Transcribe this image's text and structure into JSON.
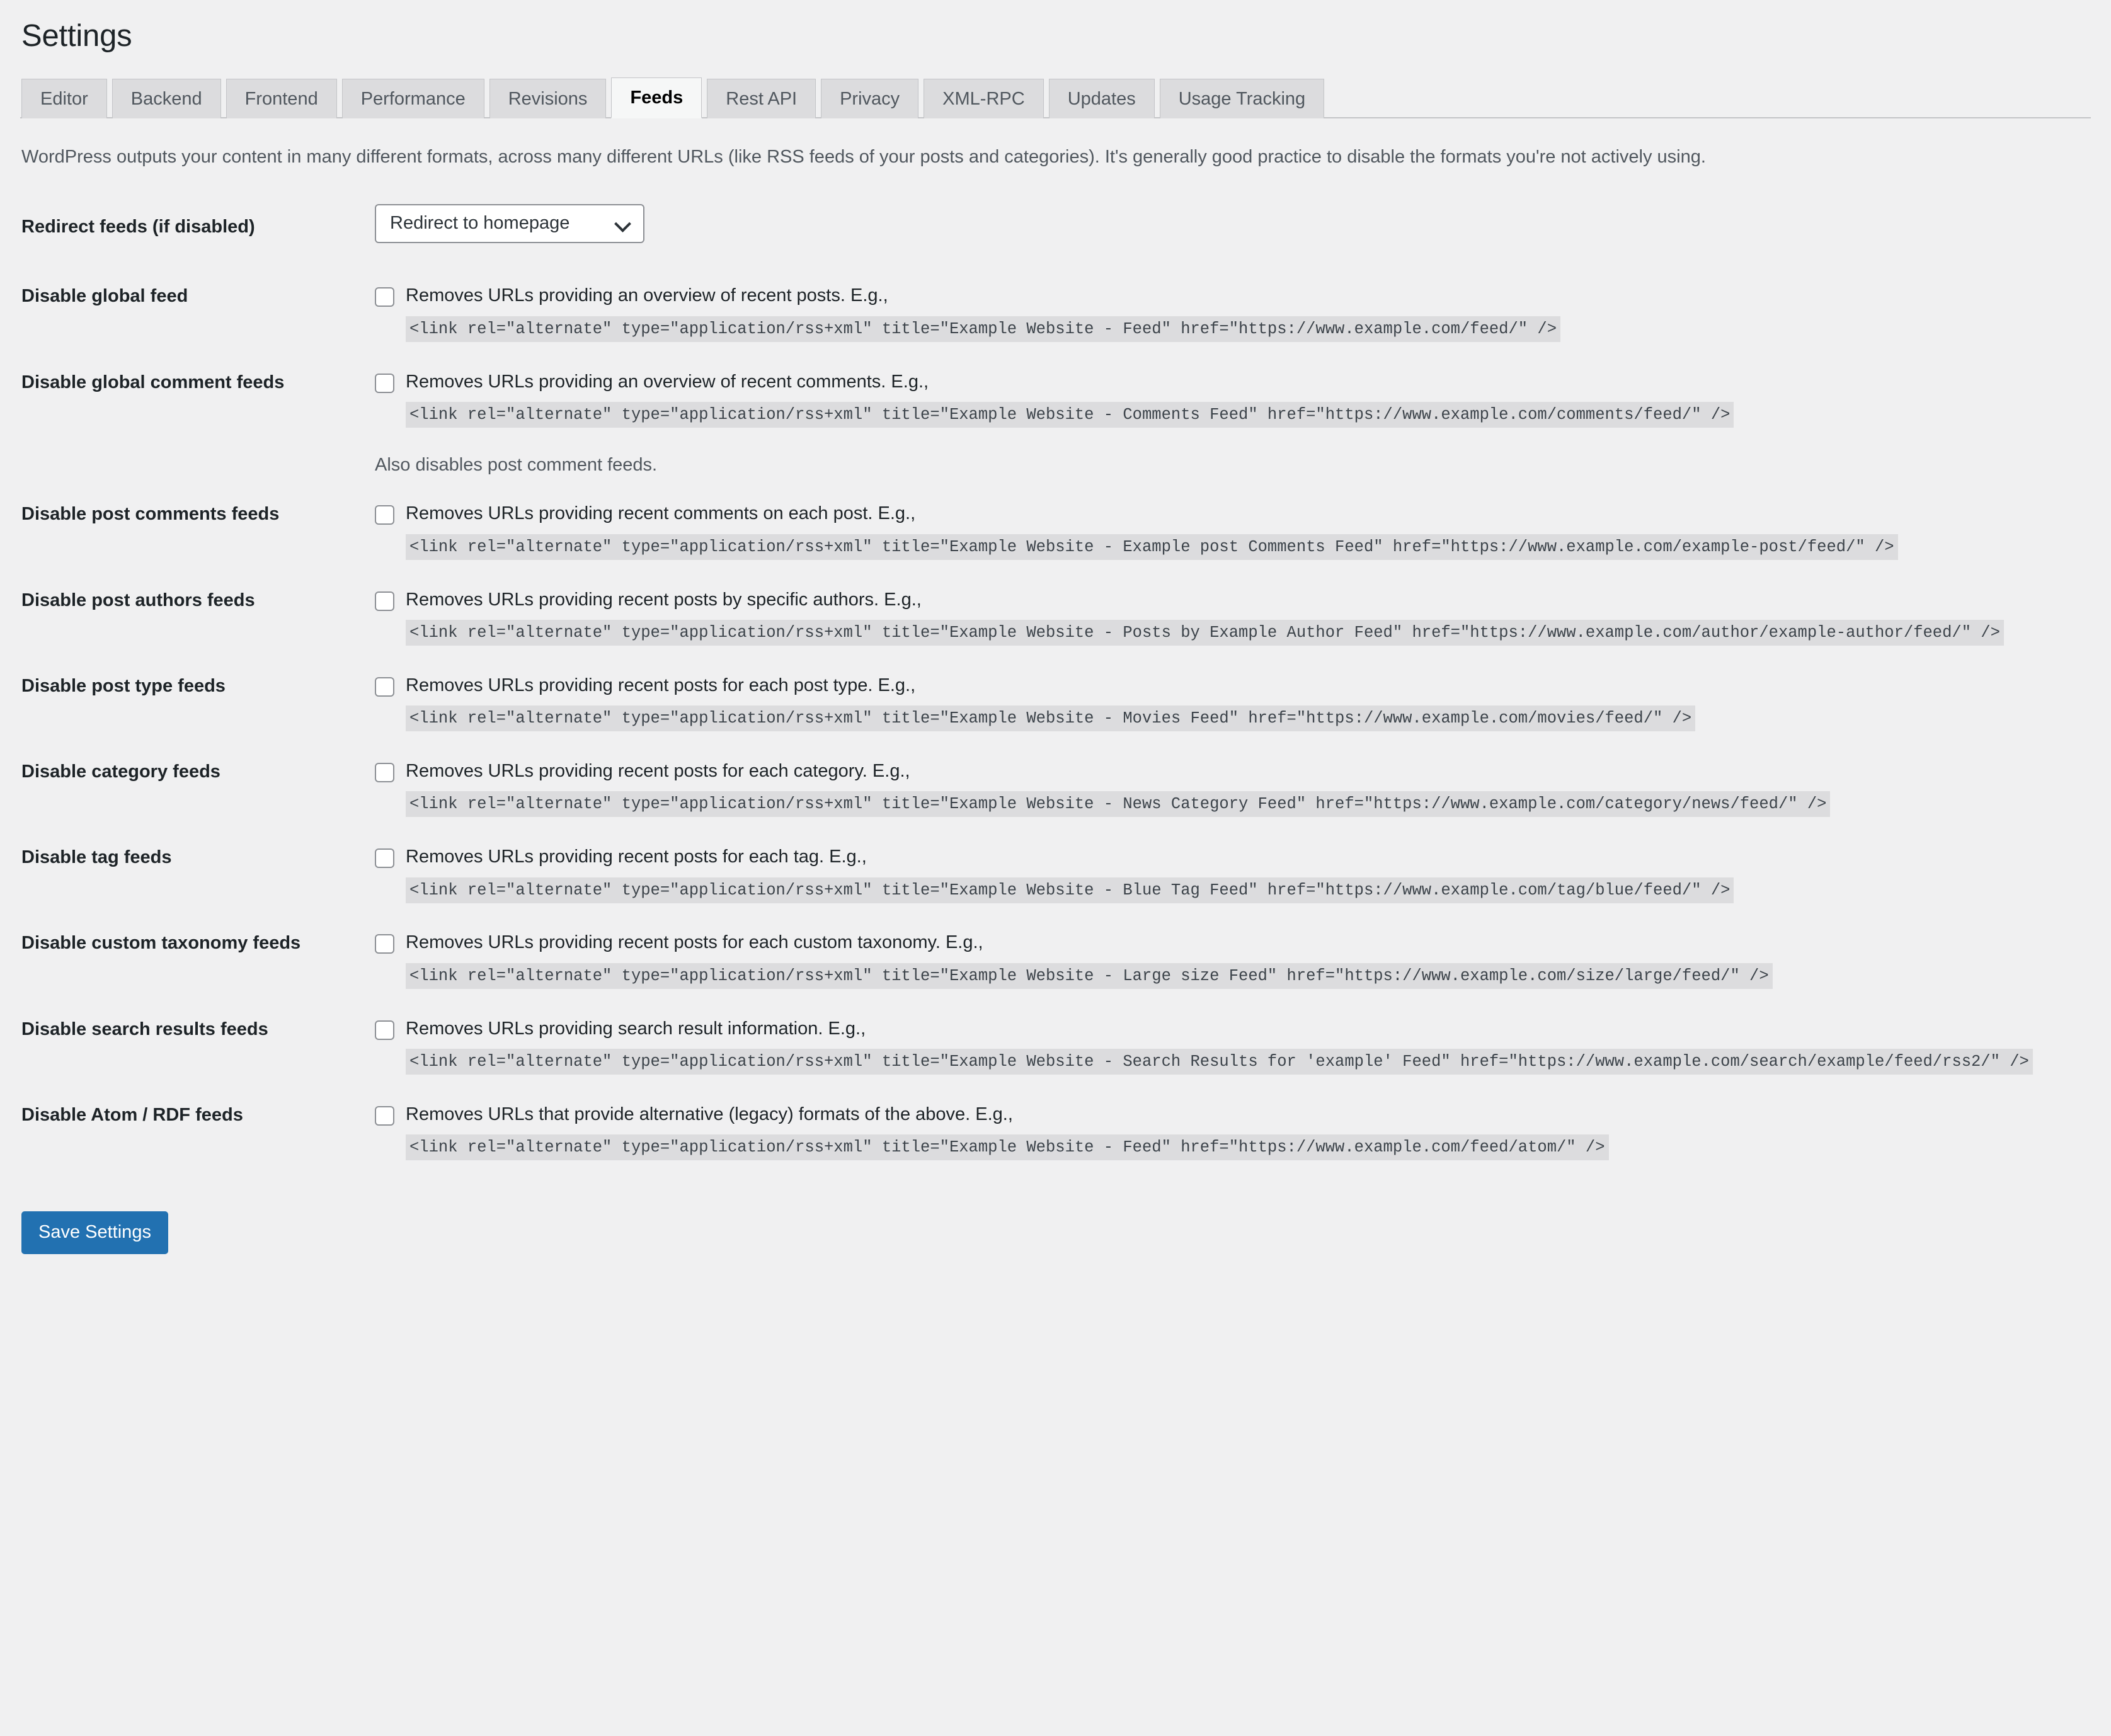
{
  "header": {
    "title": "Settings"
  },
  "tabs": [
    {
      "label": "Editor",
      "active": false
    },
    {
      "label": "Backend",
      "active": false
    },
    {
      "label": "Frontend",
      "active": false
    },
    {
      "label": "Performance",
      "active": false
    },
    {
      "label": "Revisions",
      "active": false
    },
    {
      "label": "Feeds",
      "active": true
    },
    {
      "label": "Rest API",
      "active": false
    },
    {
      "label": "Privacy",
      "active": false
    },
    {
      "label": "XML-RPC",
      "active": false
    },
    {
      "label": "Updates",
      "active": false
    },
    {
      "label": "Usage Tracking",
      "active": false
    }
  ],
  "intro": "WordPress outputs your content in many different formats, across many different URLs (like RSS feeds of your posts and categories). It's generally good practice to disable the formats you're not actively using.",
  "redirect": {
    "label": "Redirect feeds (if disabled)",
    "selected": "Redirect to homepage",
    "icon": "chevron-down-icon"
  },
  "settings": [
    {
      "label": "Disable global feed",
      "description": "Removes URLs providing an overview of recent posts. E.g.,",
      "code": "<link rel=\"alternate\" type=\"application/rss+xml\" title=\"Example Website - Feed\" href=\"https://www.example.com/feed/\" />",
      "checked": false,
      "note": ""
    },
    {
      "label": "Disable global comment feeds",
      "description": "Removes URLs providing an overview of recent comments. E.g.,",
      "code": "<link rel=\"alternate\" type=\"application/rss+xml\" title=\"Example Website - Comments Feed\" href=\"https://www.example.com/comments/feed/\" />",
      "checked": false,
      "note": "Also disables post comment feeds."
    },
    {
      "label": "Disable post comments feeds",
      "description": "Removes URLs providing recent comments on each post. E.g.,",
      "code": "<link rel=\"alternate\" type=\"application/rss+xml\" title=\"Example Website - Example post Comments Feed\" href=\"https://www.example.com/example-post/feed/\" />",
      "checked": false,
      "note": ""
    },
    {
      "label": "Disable post authors feeds",
      "description": "Removes URLs providing recent posts by specific authors. E.g.,",
      "code": "<link rel=\"alternate\" type=\"application/rss+xml\" title=\"Example Website - Posts by Example Author Feed\" href=\"https://www.example.com/author/example-author/feed/\" />",
      "checked": false,
      "note": ""
    },
    {
      "label": "Disable post type feeds",
      "description": "Removes URLs providing recent posts for each post type. E.g.,",
      "code": "<link rel=\"alternate\" type=\"application/rss+xml\" title=\"Example Website - Movies Feed\" href=\"https://www.example.com/movies/feed/\" />",
      "checked": false,
      "note": ""
    },
    {
      "label": "Disable category feeds",
      "description": "Removes URLs providing recent posts for each category. E.g.,",
      "code": "<link rel=\"alternate\" type=\"application/rss+xml\" title=\"Example Website - News Category Feed\" href=\"https://www.example.com/category/news/feed/\" />",
      "checked": false,
      "note": ""
    },
    {
      "label": "Disable tag feeds",
      "description": "Removes URLs providing recent posts for each tag. E.g.,",
      "code": "<link rel=\"alternate\" type=\"application/rss+xml\" title=\"Example Website - Blue Tag Feed\" href=\"https://www.example.com/tag/blue/feed/\" />",
      "checked": false,
      "note": ""
    },
    {
      "label": "Disable custom taxonomy feeds",
      "description": "Removes URLs providing recent posts for each custom taxonomy. E.g.,",
      "code": "<link rel=\"alternate\" type=\"application/rss+xml\" title=\"Example Website - Large size Feed\" href=\"https://www.example.com/size/large/feed/\" />",
      "checked": false,
      "note": ""
    },
    {
      "label": "Disable search results feeds",
      "description": "Removes URLs providing search result information. E.g.,",
      "code": "<link rel=\"alternate\" type=\"application/rss+xml\" title=\"Example Website - Search Results for 'example' Feed\" href=\"https://www.example.com/search/example/feed/rss2/\" />",
      "checked": false,
      "note": ""
    },
    {
      "label": "Disable Atom / RDF feeds",
      "description": "Removes URLs that provide alternative (legacy) formats of the above. E.g.,",
      "code": "<link rel=\"alternate\" type=\"application/rss+xml\" title=\"Example Website - Feed\" href=\"https://www.example.com/feed/atom/\" />",
      "checked": false,
      "note": ""
    }
  ],
  "actions": {
    "save_label": "Save Settings"
  },
  "colors": {
    "page_bg": "#f0f0f1",
    "tab_inactive_bg": "#dcdcde",
    "tab_active_bg": "#f6f7f7",
    "code_bg": "#dcdcde",
    "primary_button": "#2271b1",
    "muted_text": "#50575e"
  }
}
